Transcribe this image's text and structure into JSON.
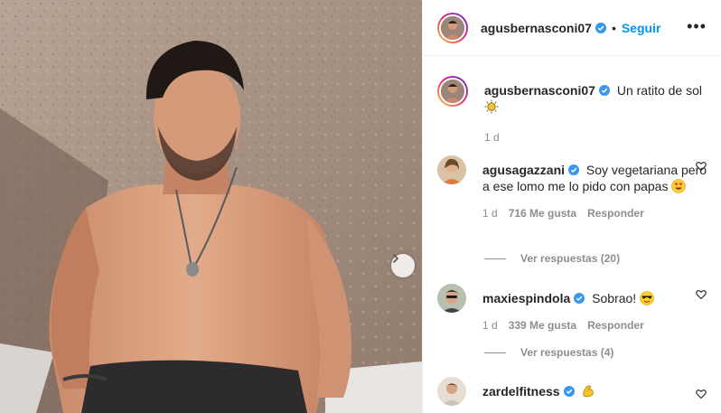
{
  "post": {
    "author": "agusbernasconi07",
    "follow_label": "Seguir",
    "dot": "•",
    "more_label": "•••",
    "caption": "Un ratito de sol",
    "caption_time": "1 d"
  },
  "comments": [
    {
      "user": "agusagazzani",
      "verified": true,
      "text": "Soy vegetariana pero a ese lomo me lo pido con papas",
      "time": "1 d",
      "likes": "716 Me gusta",
      "reply": "Responder",
      "view_replies": "Ver respuestas (20)"
    },
    {
      "user": "maxiespindola",
      "verified": true,
      "text": "Sobrao!",
      "time": "1 d",
      "likes": "339 Me gusta",
      "reply": "Responder",
      "view_replies": "Ver respuestas (4)"
    },
    {
      "user": "zardelfitness",
      "verified": true,
      "text": ""
    }
  ],
  "icons": {
    "verified": "verified-badge-icon",
    "heart": "heart-outline-icon",
    "next": "chevron-right-icon",
    "sun": "sun-emoji",
    "heart_eyes": "heart-eyes-emoji",
    "sunglasses": "sunglasses-emoji",
    "flex": "flexed-biceps-emoji"
  },
  "colors": {
    "link_blue": "#0095f6",
    "verified_blue": "#3897f0",
    "muted": "#8e8e8e",
    "text": "#262626"
  }
}
